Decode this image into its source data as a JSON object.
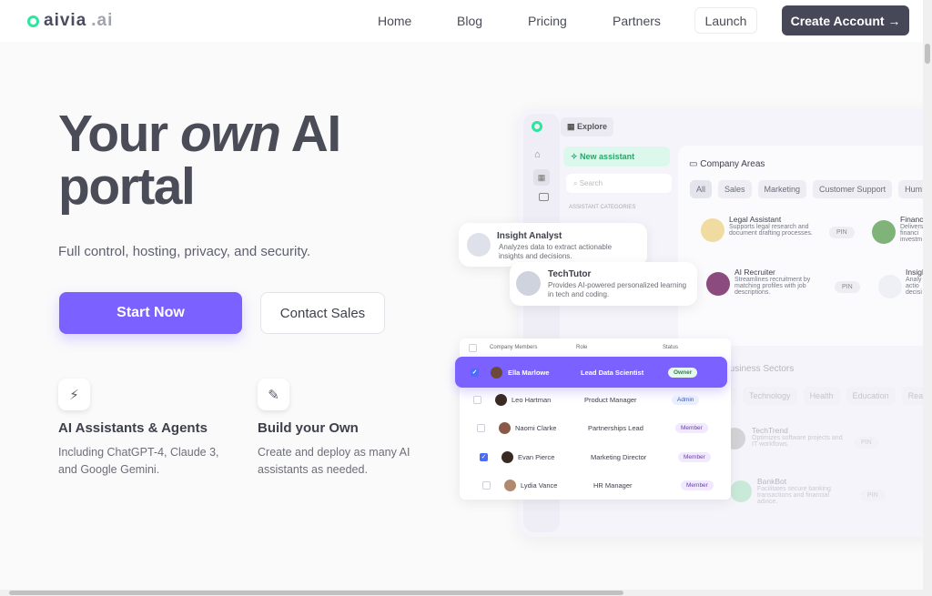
{
  "brand": {
    "name": "aivia",
    "suffix": ".ai",
    "accent": "#2ee59d"
  },
  "nav": {
    "links": [
      "Home",
      "Blog",
      "Pricing",
      "Partners"
    ],
    "launch": "Launch",
    "create": "Create Account →"
  },
  "hero": {
    "title_1": "Your ",
    "title_em": "own",
    "title_2": " AI",
    "title_3": "portal",
    "subtitle": "Full control, hosting, privacy, and security.",
    "start": "Start Now",
    "contact": "Contact Sales",
    "primary_color": "#7b61ff"
  },
  "features": [
    {
      "icon": "lightning-icon",
      "title": "AI Assistants & Agents",
      "desc": "Including ChatGPT-4, Claude 3, and Google Gemini."
    },
    {
      "icon": "pencil-icon",
      "title": "Build your Own",
      "desc": "Create and deploy as many AI assistants as needed."
    }
  ],
  "mockup": {
    "explore": "Explore",
    "new_assistant": "New assistant",
    "search_placeholder": "Search",
    "categories_label": "ASSISTANT CATEGORIES",
    "company_areas": "Company Areas",
    "area_chips": [
      "All",
      "Sales",
      "Marketing",
      "Customer Support",
      "Hum"
    ],
    "assistants": [
      {
        "name": "Legal Assistant",
        "desc": "Supports legal research and document drafting processes.",
        "pin": "PIN"
      },
      {
        "name": "Financ",
        "desc": "Delivers financi investm"
      },
      {
        "name": "AI Recruiter",
        "desc": "Streamlines recruitment by matching profiles with job descriptions.",
        "pin": "PIN"
      },
      {
        "name": "Insigh",
        "desc": "Analy actio decisi"
      }
    ],
    "floating": [
      {
        "name": "Insight Analyst",
        "desc": "Analyzes data to extract actionable insights and decisions."
      },
      {
        "name": "TechTutor",
        "desc": "Provides AI-powered personalized learning in tech and coding."
      }
    ],
    "business_sectors": "Business Sectors",
    "sector_chips": [
      "All",
      "Technology",
      "Health",
      "Education",
      "Real"
    ],
    "sector_assistants": [
      {
        "name": "TechTrend",
        "desc": "Optimizes software projects and IT workflows.",
        "pin": "PIN"
      },
      {
        "name": "BankBot",
        "desc": "Facilitates secure banking transactions and financial advice.",
        "pin": "PIN"
      }
    ],
    "table": {
      "headers": [
        "Company Members",
        "Role",
        "Status"
      ],
      "rows": [
        {
          "name": "Ella Marlowe",
          "role": "Lead Data Scientist",
          "status": "Owner",
          "checked": true
        },
        {
          "name": "Leo Hartman",
          "role": "Product Manager",
          "status": "Admin",
          "checked": false
        },
        {
          "name": "Naomi Clarke",
          "role": "Partnerships Lead",
          "status": "Member",
          "checked": false
        },
        {
          "name": "Evan Pierce",
          "role": "Marketing Director",
          "status": "Member",
          "checked": true
        },
        {
          "name": "Lydia Vance",
          "role": "HR Manager",
          "status": "Member",
          "checked": false
        }
      ]
    }
  }
}
